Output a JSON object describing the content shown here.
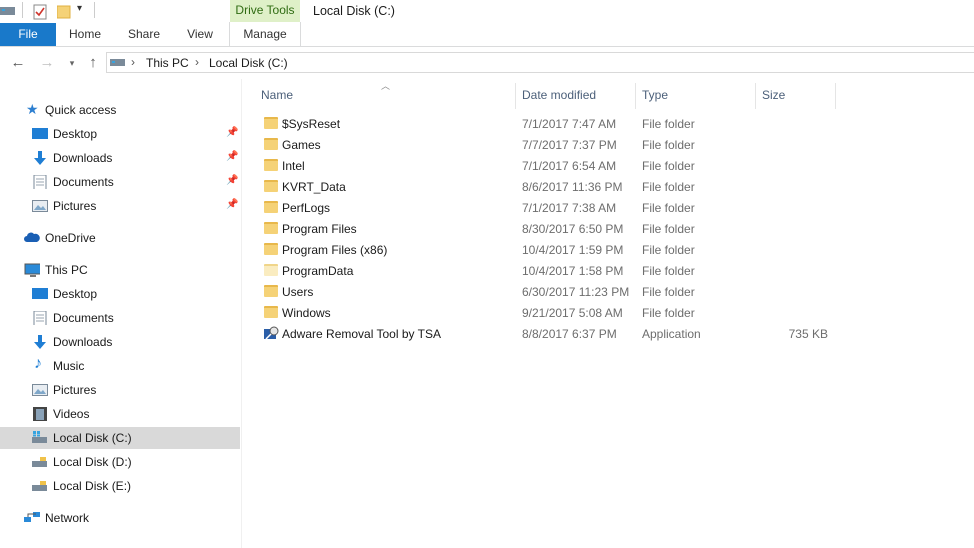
{
  "window": {
    "title": "Local Disk (C:)"
  },
  "ribbon": {
    "context_group": "Drive Tools",
    "tabs": [
      "File",
      "Home",
      "Share",
      "View",
      "Manage"
    ]
  },
  "address": {
    "crumbs": [
      "This PC",
      "Local Disk (C:)"
    ]
  },
  "nav": {
    "quick_access": "Quick access",
    "quick_items": [
      "Desktop",
      "Downloads",
      "Documents",
      "Pictures"
    ],
    "onedrive": "OneDrive",
    "this_pc": "This PC",
    "pc_items": [
      "Desktop",
      "Documents",
      "Downloads",
      "Music",
      "Pictures",
      "Videos",
      "Local Disk (C:)",
      "Local Disk (D:)",
      "Local Disk (E:)"
    ],
    "network": "Network",
    "selected": "Local Disk (C:)"
  },
  "columns": {
    "name": "Name",
    "date": "Date modified",
    "type": "Type",
    "size": "Size"
  },
  "files": [
    {
      "name": "$SysReset",
      "date": "7/1/2017 7:47 AM",
      "type": "File folder",
      "size": "",
      "icon": "folder-icon"
    },
    {
      "name": "Games",
      "date": "7/7/2017 7:37 PM",
      "type": "File folder",
      "size": "",
      "icon": "folder-icon"
    },
    {
      "name": "Intel",
      "date": "7/1/2017 6:54 AM",
      "type": "File folder",
      "size": "",
      "icon": "folder-icon"
    },
    {
      "name": "KVRT_Data",
      "date": "8/6/2017 11:36 PM",
      "type": "File folder",
      "size": "",
      "icon": "folder-icon"
    },
    {
      "name": "PerfLogs",
      "date": "7/1/2017 7:38 AM",
      "type": "File folder",
      "size": "",
      "icon": "folder-icon"
    },
    {
      "name": "Program Files",
      "date": "8/30/2017 6:50 PM",
      "type": "File folder",
      "size": "",
      "icon": "folder-icon"
    },
    {
      "name": "Program Files (x86)",
      "date": "10/4/2017 1:59 PM",
      "type": "File folder",
      "size": "",
      "icon": "folder-icon"
    },
    {
      "name": "ProgramData",
      "date": "10/4/2017 1:58 PM",
      "type": "File folder",
      "size": "",
      "icon": "hidden-folder-icon"
    },
    {
      "name": "Users",
      "date": "6/30/2017 11:23 PM",
      "type": "File folder",
      "size": "",
      "icon": "folder-icon"
    },
    {
      "name": "Windows",
      "date": "9/21/2017 5:08 AM",
      "type": "File folder",
      "size": "",
      "icon": "folder-icon"
    },
    {
      "name": "Adware Removal Tool by TSA",
      "date": "8/8/2017 6:37 PM",
      "type": "Application",
      "size": "735 KB",
      "icon": "application-icon"
    }
  ],
  "colors": {
    "accent": "#1979ca",
    "context_tab_bg": "#dff0c8",
    "context_tab_text": "#2f6b12",
    "selection": "#d9d9d9"
  }
}
